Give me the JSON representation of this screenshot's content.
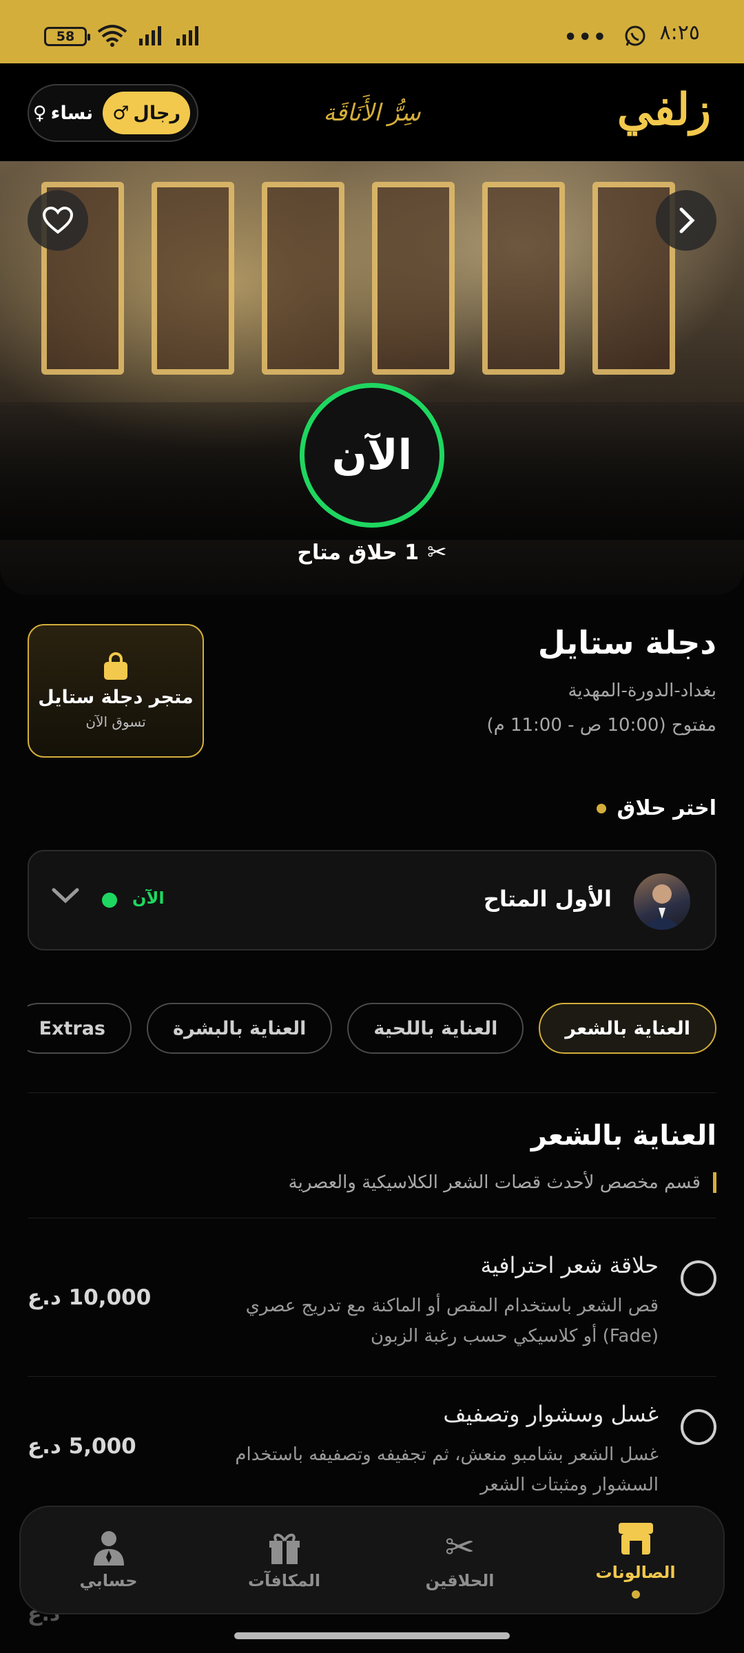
{
  "status_bar": {
    "time": "٨:٢٥",
    "battery": "58"
  },
  "header": {
    "brand": "زلفي",
    "slogan": "سِرُّ الأَنَاقَة",
    "gender": {
      "men": "رجال",
      "women": "نساء"
    }
  },
  "hero": {
    "now_label": "الآن",
    "available_text": "1 حلاق متاح"
  },
  "salon": {
    "name": "دجلة ستايل",
    "location": "بغداد-الدورة-المهدية",
    "hours": "مفتوح (10:00 ص - 11:00 م)"
  },
  "store": {
    "title": "متجر دجلة ستايل",
    "subtitle": "تسوق الآن"
  },
  "barber_select": {
    "label": "اختر حلاق",
    "barber_name": "الأول المتاح",
    "status": "الآن"
  },
  "categories": [
    "العناية بالشعر",
    "العناية باللحية",
    "العناية بالبشرة",
    "Extras"
  ],
  "category_section": {
    "title": "العناية بالشعر",
    "description": "قسم مخصص لأحدث قصات الشعر الكلاسيكية والعصرية"
  },
  "services": [
    {
      "name": "حلاقة شعر احترافية",
      "description": "قص الشعر باستخدام المقص أو الماكنة مع تدريج عصري (Fade) أو كلاسيكي حسب رغبة الزبون",
      "price": "10,000 د.ع"
    },
    {
      "name": "غسل وسشوار وتصفيف",
      "description": "غسل الشعر بشامبو منعش، ثم تجفيفه وتصفيفه باستخدام السشوار ومثبتات الشعر",
      "price": "5,000 د.ع"
    }
  ],
  "nav": [
    {
      "label": "الصالونات",
      "icon": "store-icon",
      "active": true
    },
    {
      "label": "الحلاقين",
      "icon": "scissors-icon",
      "active": false
    },
    {
      "label": "المكافآت",
      "icon": "gift-icon",
      "active": false
    },
    {
      "label": "حسابي",
      "icon": "person-icon",
      "active": false
    }
  ],
  "peek_text": "د.ع",
  "colors": {
    "gold": "#d4ae3b",
    "brand_yellow": "#f2c94c",
    "green": "#1ed760",
    "background": "#050505"
  }
}
